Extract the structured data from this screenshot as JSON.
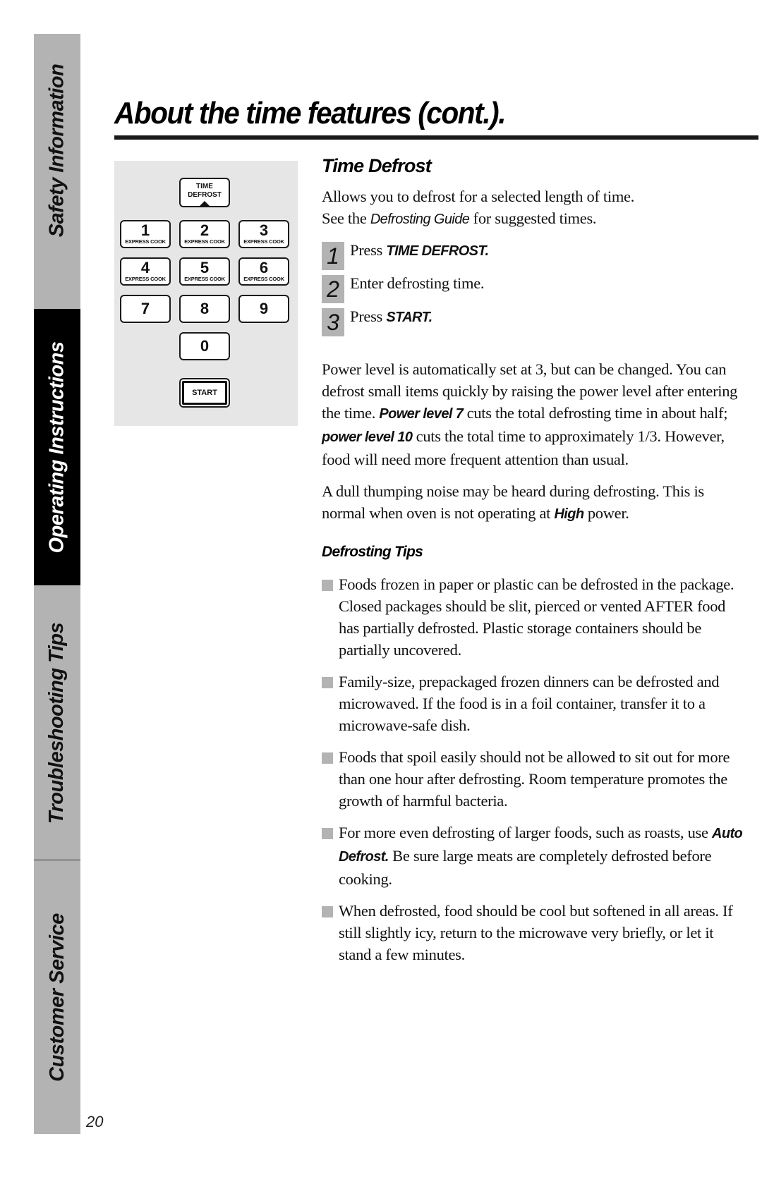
{
  "sidebar": {
    "tabs": [
      {
        "label": "Safety Information",
        "active": false
      },
      {
        "label": "Operating Instructions",
        "active": true
      },
      {
        "label": "Troubleshooting Tips",
        "active": false
      },
      {
        "label": "Customer Service",
        "active": false
      }
    ]
  },
  "page_number": "20",
  "title": "About the time features (cont.).",
  "keypad": {
    "time_defrost_line1": "TIME",
    "time_defrost_line2": "DEFROST",
    "keys": [
      {
        "num": "1",
        "sub": "EXPRESS COOK"
      },
      {
        "num": "2",
        "sub": "EXPRESS COOK"
      },
      {
        "num": "3",
        "sub": "EXPRESS COOK"
      },
      {
        "num": "4",
        "sub": "EXPRESS COOK"
      },
      {
        "num": "5",
        "sub": "EXPRESS COOK"
      },
      {
        "num": "6",
        "sub": "EXPRESS COOK"
      },
      {
        "num": "7",
        "sub": ""
      },
      {
        "num": "8",
        "sub": ""
      },
      {
        "num": "9",
        "sub": ""
      },
      {
        "num": "0",
        "sub": ""
      }
    ],
    "start_label": "START"
  },
  "section": {
    "heading": "Time Defrost",
    "intro_line1": "Allows you to defrost for a selected length of time.",
    "intro_line2_pre": "See the ",
    "intro_line2_em": "Defrosting Guide",
    "intro_line2_post": " for suggested times.",
    "steps": [
      {
        "num": "1",
        "pre": "Press ",
        "strong": "TIME DEFROST.",
        "post": ""
      },
      {
        "num": "2",
        "pre": "Enter defrosting time.",
        "strong": "",
        "post": ""
      },
      {
        "num": "3",
        "pre": "Press ",
        "strong": "START.",
        "post": ""
      }
    ],
    "power_para": {
      "t1": "Power level is automatically set at 3, but can be changed. You can defrost small items quickly by raising the power level after entering the time. ",
      "s1": "Power level 7",
      "t2": " cuts the total defrosting time in about half; ",
      "s2": "power level 10",
      "t3": " cuts the total time to approximately 1/3. However, food will need more frequent attention than usual."
    },
    "noise_para": {
      "t1": "A dull thumping noise may be heard during defrosting. This is normal when oven is not operating at ",
      "s1": "High",
      "t2": " power."
    }
  },
  "tips": {
    "heading": "Defrosting Tips",
    "items": [
      {
        "pre": "Foods frozen in paper or plastic can be defrosted in the package. Closed packages should be slit, pierced or vented AFTER food has partially defrosted. Plastic storage containers should be partially uncovered.",
        "strong": "",
        "post": ""
      },
      {
        "pre": "Family-size, prepackaged frozen dinners can be defrosted and microwaved. If the food is in a foil container, transfer it to a microwave-safe dish.",
        "strong": "",
        "post": ""
      },
      {
        "pre": "Foods that spoil easily should not be allowed to sit out for more than one hour after defrosting. Room temperature promotes the growth of harmful bacteria.",
        "strong": "",
        "post": ""
      },
      {
        "pre": "For more even defrosting of larger foods, such as roasts, use ",
        "strong": "Auto Defrost.",
        "post": " Be sure large meats are completely defrosted before cooking."
      },
      {
        "pre": "When defrosted, food should be cool but softened in all areas. If still slightly icy, return to the microwave very briefly, or let it stand a few minutes.",
        "strong": "",
        "post": ""
      }
    ]
  },
  "colors": {
    "tab_gray": "#b3b3b3",
    "tab_active": "#000000",
    "keypad_bg": "#e6e6e6",
    "bullet_gray": "#b3b3b3"
  }
}
